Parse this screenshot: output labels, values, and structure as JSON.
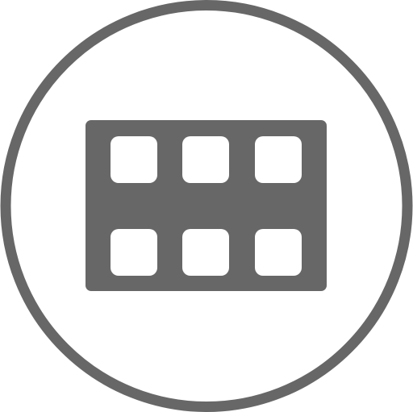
{
  "icon": {
    "name": "film-strip-icon",
    "color": "#676767",
    "background": "#ffffff"
  }
}
